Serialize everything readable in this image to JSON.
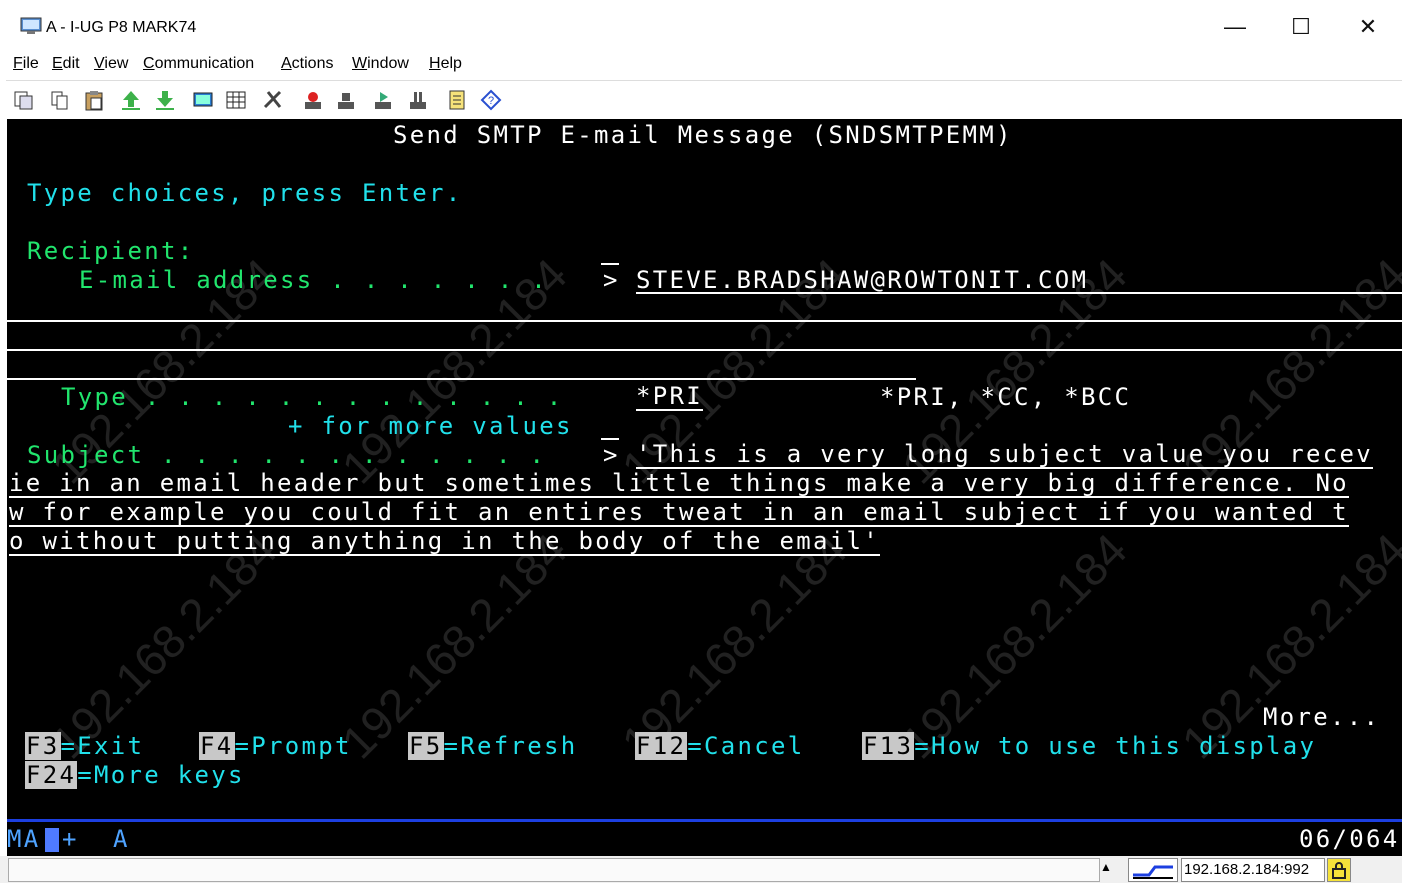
{
  "window": {
    "title": "A - I-UG P8 MARK74",
    "minimize": "—",
    "maximize": "☐",
    "close": "✕"
  },
  "menu": [
    "File",
    "Edit",
    "View",
    "Communication",
    "Actions",
    "Window",
    "Help"
  ],
  "toolbar_icons": [
    "copy-icon",
    "copy-append-icon",
    "paste-icon",
    "send-file-icon",
    "receive-file-icon",
    "display-icon",
    "keypad-icon",
    "macro-icon",
    "record-icon",
    "stop-icon",
    "play-icon",
    "pause-icon",
    "notes-icon",
    "help-icon"
  ],
  "screen": {
    "heading": "Send SMTP E-mail Message (SNDSMTPEMM)",
    "instructions": "Type choices, press Enter.",
    "recipient_label": "Recipient:",
    "email_label": "E-mail address . . . . . . . ",
    "email_prompt": ">",
    "email_value": "STEVE.BRADSHAW@ROWTONIT.COM",
    "type_label": "Type . . . . . . . . . . . . . ",
    "type_value": "*PRI",
    "type_choices": "*PRI, *CC, *BCC",
    "more_values": "+ for more values",
    "more_values_cursor": "_",
    "subject_label": "Subject . . . . . . . . . . . . ",
    "subject_prompt": ">",
    "subject_line1": "'This is a very long subject value you recev",
    "subject_line2": "ie in an email header but sometimes little things make a very big difference. No",
    "subject_line3": "w for example you could fit an entires tweat in an email subject if you wanted t",
    "subject_line4": "o without putting anything in the body of the email'",
    "more": "More...",
    "fkeys": [
      {
        "key": "F3",
        "label": "=Exit"
      },
      {
        "key": "F4",
        "label": "=Prompt"
      },
      {
        "key": "F5",
        "label": "=Refresh"
      },
      {
        "key": "F12",
        "label": "=Cancel"
      },
      {
        "key": "F13",
        "label": "=How to use this display"
      },
      {
        "key": "F24",
        "label": "=More keys"
      }
    ],
    "watermark": "192.168.2.184"
  },
  "oia": {
    "left": "MA",
    "plus": "+",
    "session": "A",
    "cursor_pos": "06/064"
  },
  "status": {
    "host": "192.168.2.184:992"
  },
  "colors": {
    "cyan": "#21e0ea",
    "green": "#21e56d",
    "white": "#ffffff",
    "oia_blue": "#1c3fe0"
  }
}
